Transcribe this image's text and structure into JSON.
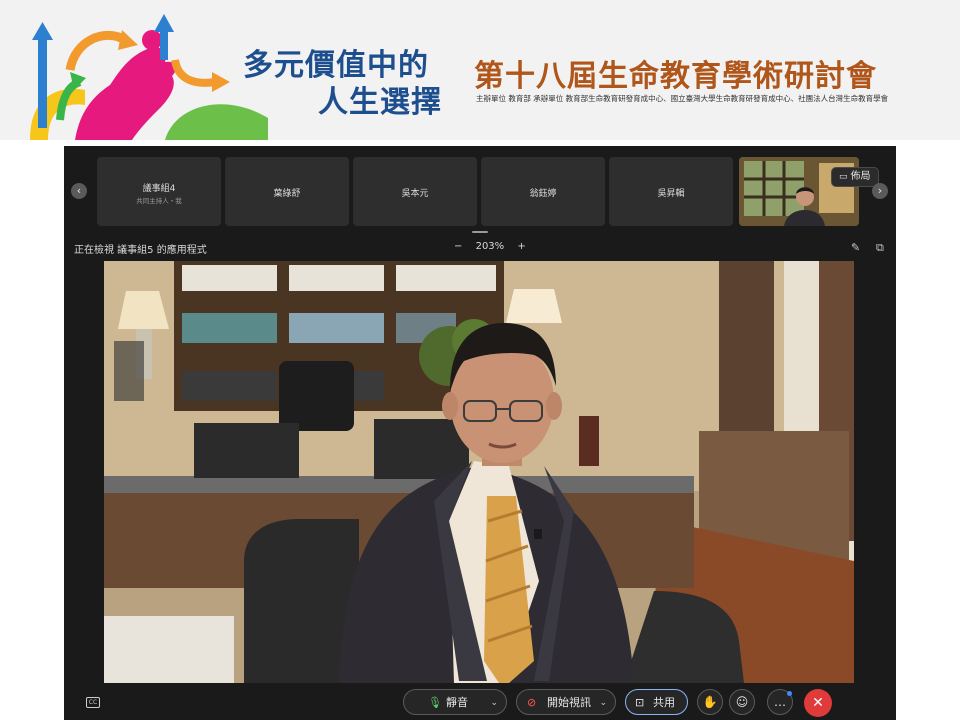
{
  "banner": {
    "theme_line1": "多元價值中的",
    "theme_line2": "人生選擇",
    "conference_title": "第十八屆生命教育學術研討會",
    "sponsors": "主辦單位 教育部   承辦單位 教育部生命教育研發育成中心、國立臺灣大學生命教育研發育成中心、社團法人台灣生命教育學會",
    "colors": {
      "theme": "#1d4f8f",
      "title": "#b0561a"
    }
  },
  "participants": {
    "tiles": [
      {
        "name": "議事組4",
        "subtitle": "共同主持人・我"
      },
      {
        "name": "葉綠舒",
        "subtitle": ""
      },
      {
        "name": "吳本元",
        "subtitle": ""
      },
      {
        "name": "翁鈺婷",
        "subtitle": ""
      },
      {
        "name": "吳昇輯",
        "subtitle": ""
      }
    ],
    "layout_button": "佈局"
  },
  "share": {
    "viewing_label": "正在檢視 議事組5 的應用程式",
    "zoom_level": "203%",
    "zoom_out": "−",
    "zoom_in": "+"
  },
  "toolbar": {
    "mute_label": "靜音",
    "start_video_label": "開始視訊",
    "share_label": "共用",
    "leave_color": "#e03b3b",
    "accent": "#3d8bfd"
  }
}
